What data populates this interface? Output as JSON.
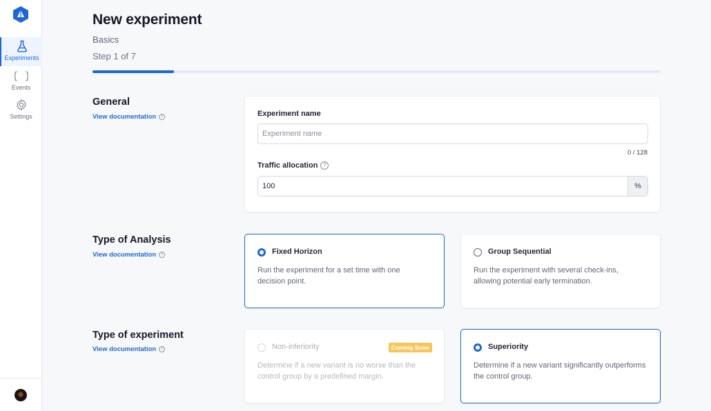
{
  "sidebar": {
    "items": [
      {
        "label": "Experiments",
        "icon": "flask-icon"
      },
      {
        "label": "Events",
        "icon": "braces-icon"
      },
      {
        "label": "Settings",
        "icon": "gear-icon"
      }
    ]
  },
  "header": {
    "title": "New experiment",
    "subtitle": "Basics",
    "step": "Step 1 of 7",
    "progress_fraction": 0.143
  },
  "general": {
    "title": "General",
    "doc_link": "View documentation",
    "name_label": "Experiment name",
    "name_placeholder": "Experiment name",
    "name_value": "",
    "char_count": "0 / 128",
    "traffic_label": "Traffic allocation",
    "traffic_value": "100",
    "traffic_unit": "%"
  },
  "analysis": {
    "title": "Type of Analysis",
    "doc_link": "View documentation",
    "options": [
      {
        "title": "Fixed Horizon",
        "desc": "Run the experiment for a set time with one decision point.",
        "selected": true
      },
      {
        "title": "Group Sequential",
        "desc": "Run the experiment with several check-ins, allowing potential early termination.",
        "selected": false
      }
    ]
  },
  "experiment_type": {
    "title": "Type of experiment",
    "doc_link": "View documentation",
    "options": [
      {
        "title": "Non-inferiority",
        "desc": "Determine if a new variant is no worse than the control group by a predefined margin.",
        "badge": "Coming Soon",
        "disabled": true,
        "selected": false
      },
      {
        "title": "Superiority",
        "desc": "Determine if a new variant significantly outperforms the control group.",
        "selected": true
      }
    ]
  },
  "colors": {
    "accent": "#1e66d6",
    "badge": "#f6c65b",
    "background": "#f7f8fa"
  }
}
